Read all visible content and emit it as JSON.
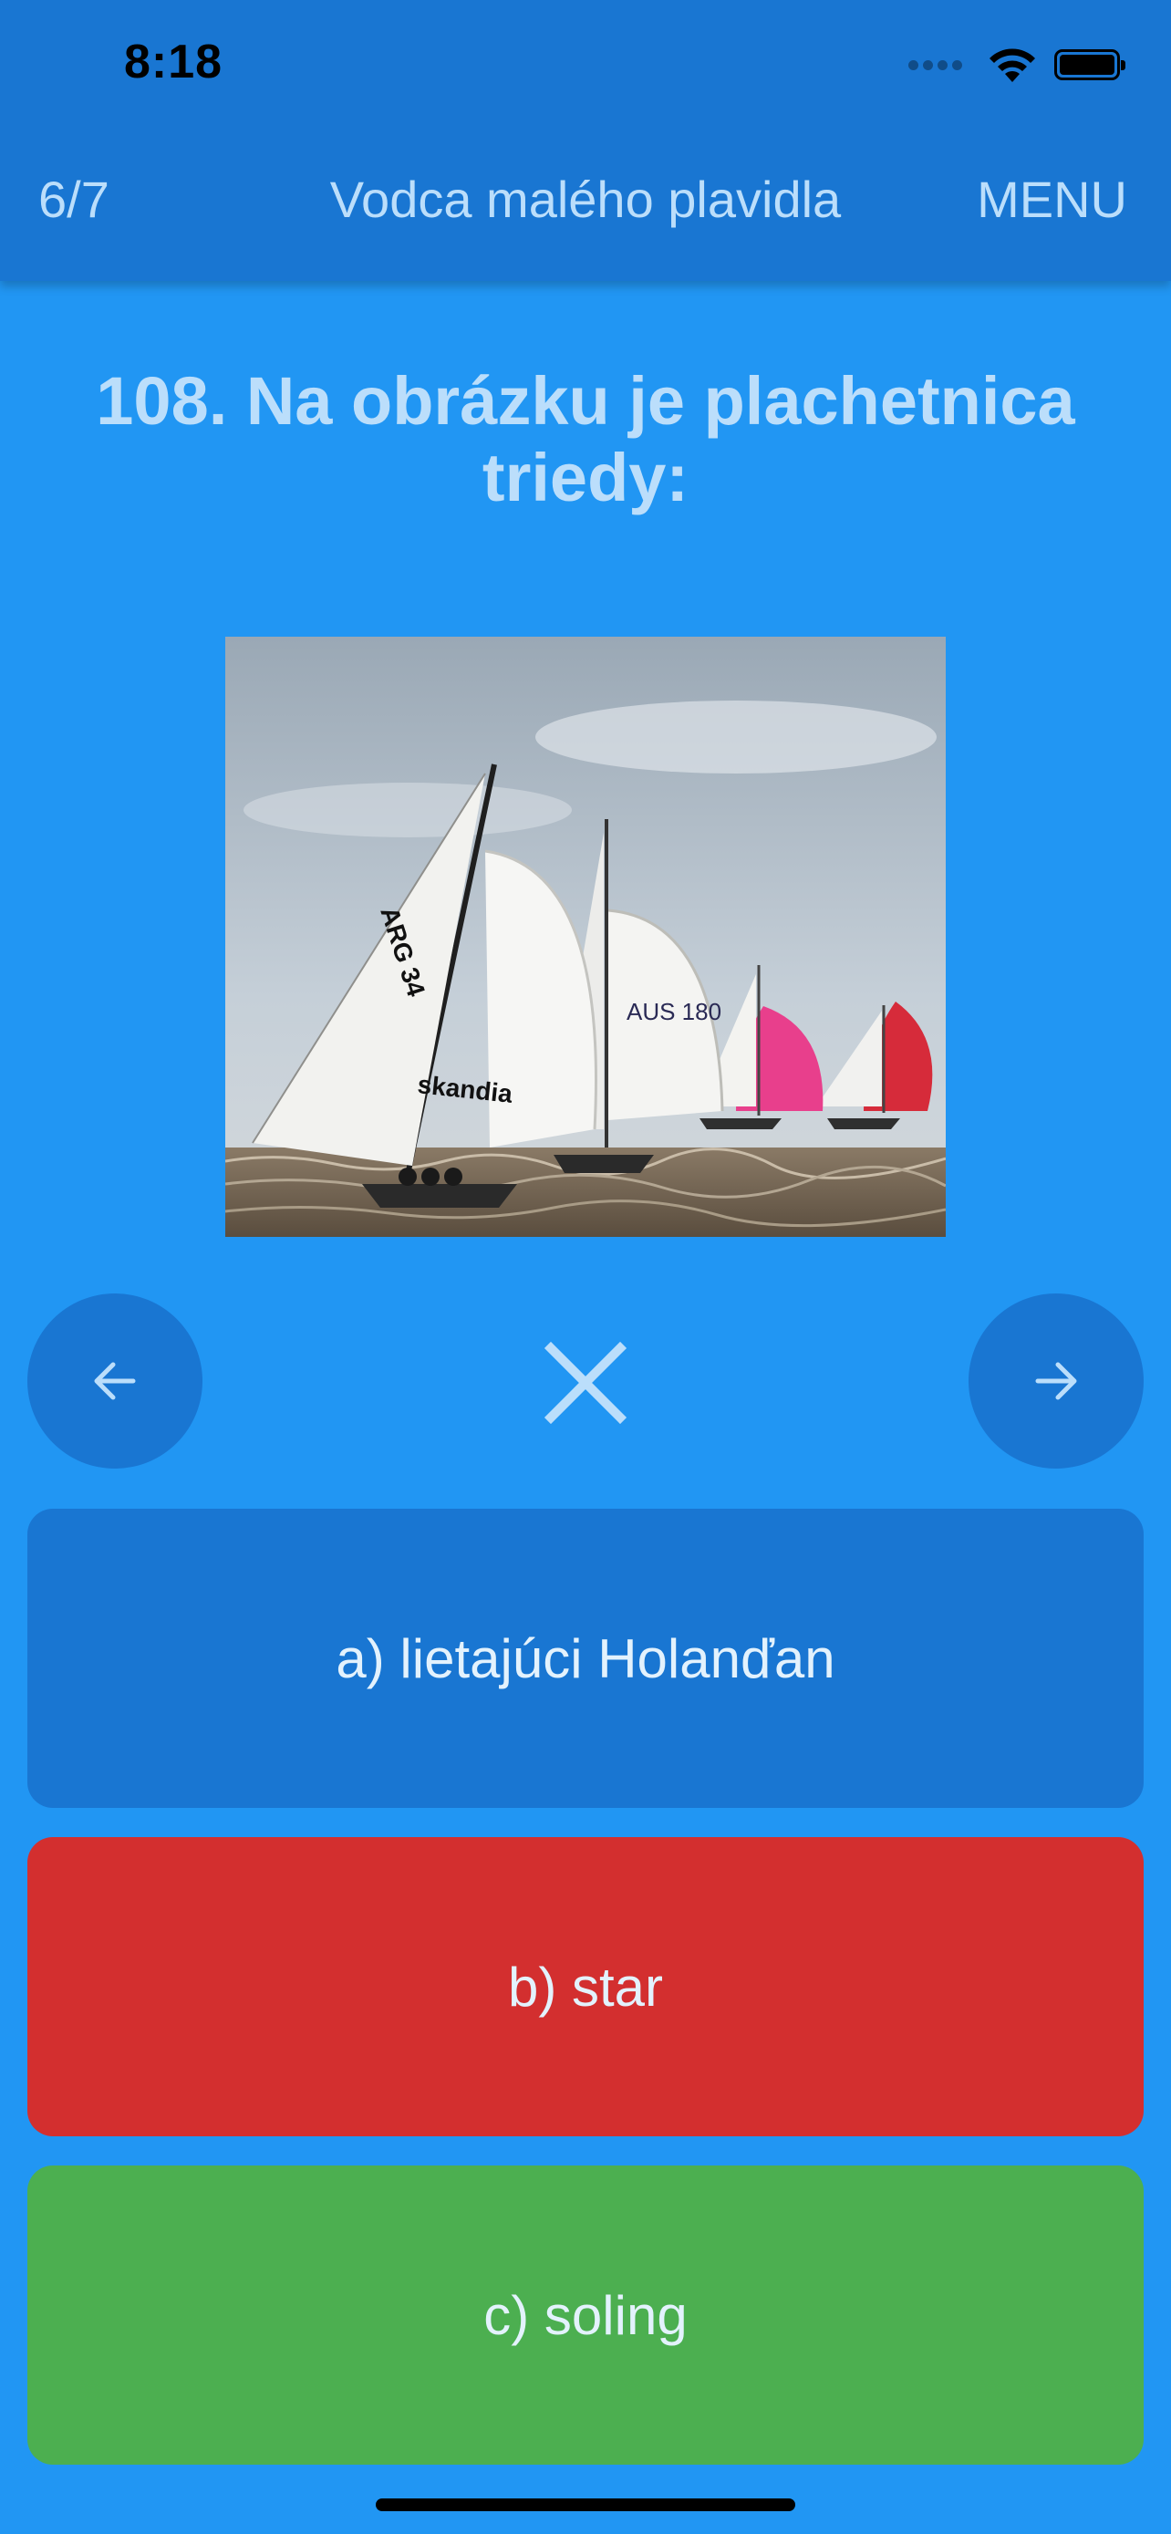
{
  "status_bar": {
    "time": "8:18"
  },
  "header": {
    "progress": "6/7",
    "title": "Vodca malého plavidla",
    "menu_label": "MENU"
  },
  "question": {
    "text": "108. Na obrázku je plachetnica triedy:",
    "image_icon": "sailboat-photo"
  },
  "navigation": {
    "prev_icon": "arrow-left-icon",
    "next_icon": "arrow-right-icon",
    "result_icon": "close-icon"
  },
  "answers": [
    {
      "label": "a) lietajúci Holanďan",
      "color": "#1976D2"
    },
    {
      "label": "b) star",
      "color": "#D32F2F"
    },
    {
      "label": "c) soling",
      "color": "#4CAF50"
    }
  ],
  "photo_text": {
    "sail_1": "skandia",
    "sail_2": "ARG 34",
    "sail_3": "AUS 180"
  },
  "colors": {
    "background": "#2196F3",
    "header": "#1976D2",
    "text_light": "#BBDEFB"
  }
}
